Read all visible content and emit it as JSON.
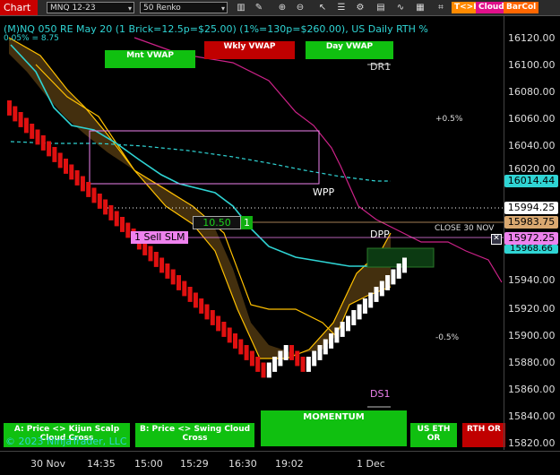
{
  "toolbar": {
    "chart_tab": "Chart",
    "instrument": "MNQ 12-23",
    "bar_type": "50 Renko",
    "ext_tk": "T<>K",
    "ext_cloud": "Cloud",
    "ext_barcol": "BarCol",
    "icons": [
      "bars-icon",
      "draw-icon",
      "zoom-in-icon",
      "zoom-out-icon",
      "cursor-icon",
      "properties-icon",
      "strategy-icon",
      "chart-trader-icon",
      "indicators-icon",
      "templates-icon",
      "attach-icon",
      "window-icon"
    ]
  },
  "title": "(M)NQ 050 RE May 20 (1 Brick=12.5p=$25.00) (1%=130p=$260.00), US Daily RTH %",
  "subtitle": "0.05% = 8.75",
  "copyright": "© 2023 NinjaTrader, LLC",
  "buttons": {
    "mnt_vwap": "Mnt VWAP",
    "wkly_vwap": "Wkly VWAP",
    "day_vwap": "Day VWAP",
    "kijun": "A: Price <> Kijun Scalp Cloud Cross",
    "swing": "B: Price <> Swing Cloud Cross",
    "momentum": "MOMENTUM",
    "us_eth": "US ETH OR",
    "rth_or": "RTH OR"
  },
  "labels": {
    "dr1": "DR1",
    "ds1": "DS1",
    "wpp": "WPP",
    "dpp": "DPP",
    "pct_up": "+0.5%",
    "pct_down": "-0.5%",
    "close_30nov": "CLOSE 30 NOV",
    "sell_order": "1 Sell SLM",
    "order_price": "10.50",
    "order_qty": "1"
  },
  "axis": {
    "y_ticks": [
      "16120.00",
      "16100.00",
      "16080.00",
      "16060.00",
      "16040.00",
      "16020.00",
      "15940.00",
      "15920.00",
      "15900.00",
      "15880.00",
      "15860.00",
      "15840.00",
      "15820.00"
    ],
    "x_ticks": [
      "30 Nov",
      "14:35",
      "15:00",
      "15:29",
      "16:30",
      "19:02",
      "1 Dec"
    ],
    "price_labels": [
      {
        "value": "16014.44",
        "color": "#2fd4d4"
      },
      {
        "value": "15994.25",
        "color": "#ffffff"
      },
      {
        "value": "15983.75",
        "color": "#d9a870"
      },
      {
        "value": "15972.25",
        "color": "#ee82ee"
      },
      {
        "value": "15968.66",
        "color": "#2fd4d4"
      }
    ]
  },
  "colors": {
    "up_brick": "#ffffff",
    "down_brick": "#e01010",
    "kijun_cloud": "#4a3410",
    "cloud_edge": "#ffc000",
    "vwap": "#2fd4d4",
    "weekly_line": "#cc2288",
    "box_outline": "#ee82ee"
  }
}
